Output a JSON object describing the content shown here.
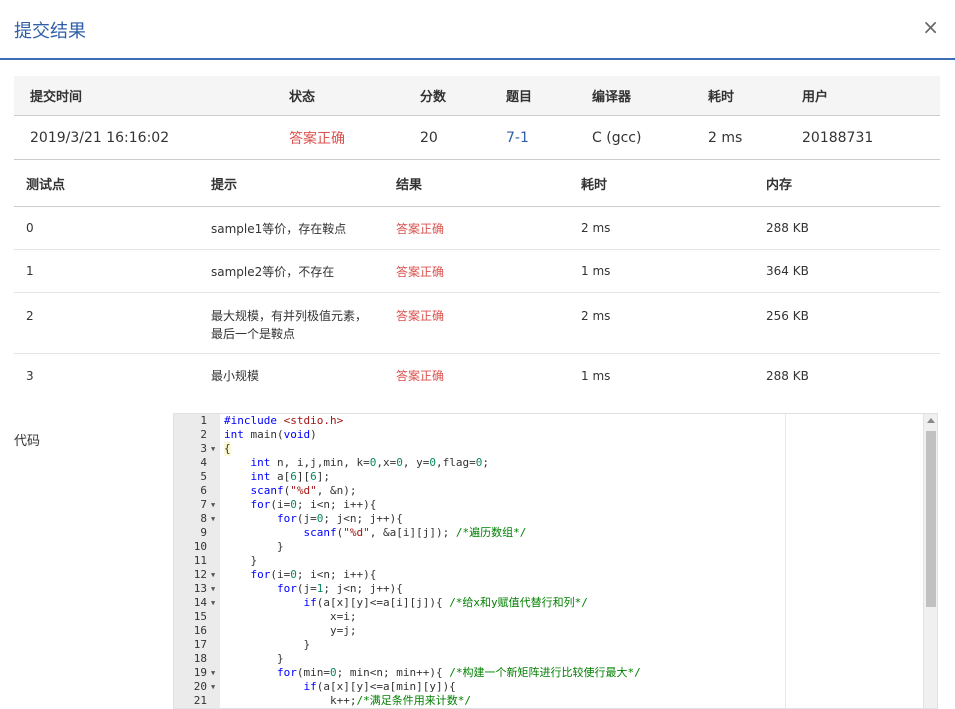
{
  "modal": {
    "title": "提交结果",
    "close": "×"
  },
  "summary": {
    "headers": [
      "提交时间",
      "状态",
      "分数",
      "题目",
      "编译器",
      "耗时",
      "用户"
    ],
    "values": [
      "2019/3/21 16:16:02",
      "答案正确",
      "20",
      "7-1",
      "C (gcc)",
      "2 ms",
      "20188731"
    ]
  },
  "testpoints": {
    "headers": [
      "测试点",
      "提示",
      "结果",
      "耗时",
      "内存"
    ],
    "rows": [
      {
        "id": "0",
        "hint": "sample1等价，存在鞍点",
        "result": "答案正确",
        "time": "2 ms",
        "memory": "288 KB"
      },
      {
        "id": "1",
        "hint": "sample2等价，不存在",
        "result": "答案正确",
        "time": "1 ms",
        "memory": "364 KB"
      },
      {
        "id": "2",
        "hint": "最大规模，有并列极值元素，最后一个是鞍点",
        "result": "答案正确",
        "time": "2 ms",
        "memory": "256 KB"
      },
      {
        "id": "3",
        "hint": "最小规模",
        "result": "答案正确",
        "time": "1 ms",
        "memory": "288 KB"
      }
    ]
  },
  "code_label": "代码",
  "code_lines": [
    "#include <stdio.h>",
    "int main(void)",
    "{",
    "    int n, i,j,min, k=0,x=0, y=0,flag=0;",
    "    int a[6][6];",
    "    scanf(\"%d\", &n);",
    "    for(i=0; i<n; i++){",
    "        for(j=0; j<n; j++){",
    "            scanf(\"%d\", &a[i][j]); /*遍历数组*/",
    "        }",
    "    }",
    "    for(i=0; i<n; i++){",
    "        for(j=1; j<n; j++){",
    "            if(a[x][y]<=a[i][j]){ /*给x和y赋值代替行和列*/",
    "                x=i;",
    "                y=j;",
    "            }",
    "        }",
    "        for(min=0; min<n; min++){ /*构建一个新矩阵进行比较使行最大*/",
    "            if(a[x][y]<=a[min][y]){",
    "                k++;/*满足条件用来计数*/"
  ],
  "fold_lines": [
    3,
    7,
    8,
    12,
    13,
    14,
    19,
    20
  ]
}
